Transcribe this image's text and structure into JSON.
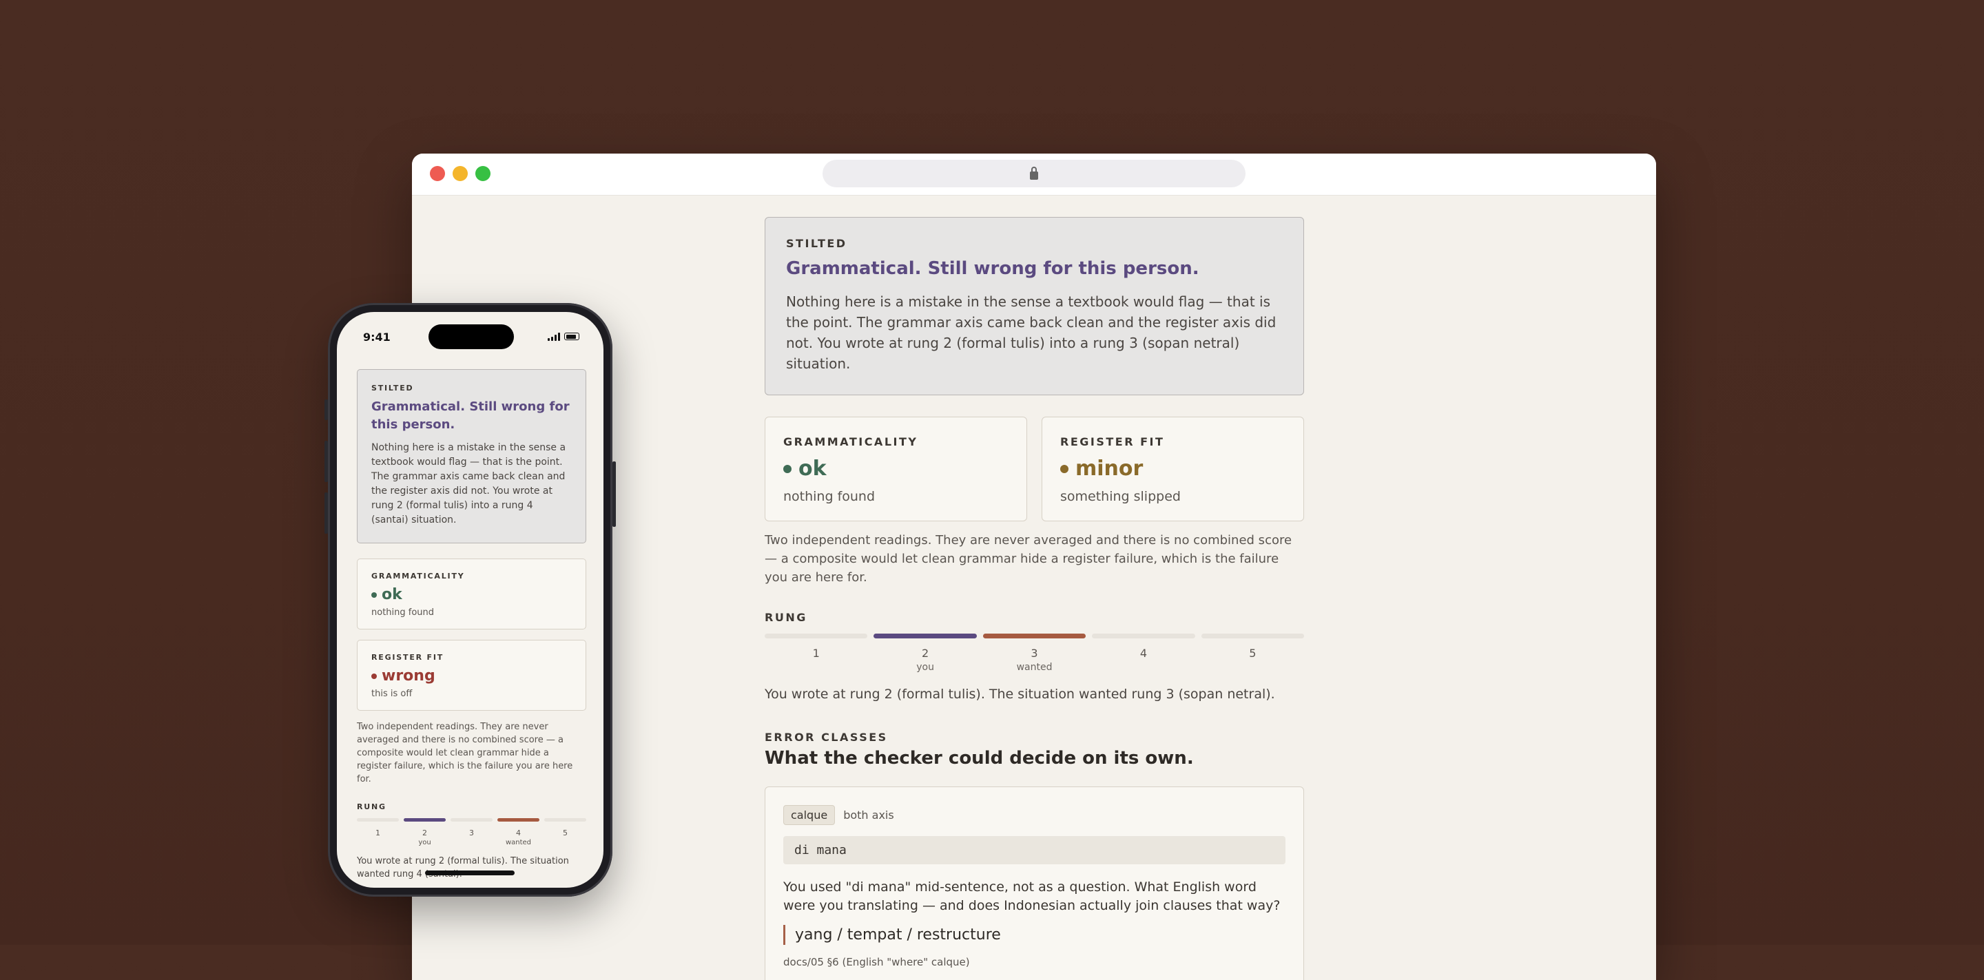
{
  "colors": {
    "accent": "#5b4a80",
    "ok": "#3f6b55",
    "minor": "#8a6a2a",
    "wrong": "#9b3b34",
    "you_bar": "#5b4a80",
    "wanted_bar": "#a65a40"
  },
  "desktop": {
    "verdict": {
      "label": "STILTED",
      "title": "Grammatical. Still wrong for this person.",
      "body": "Nothing here is a mistake in the sense a textbook would flag — that is the point. The grammar axis came back clean and the register axis did not. You wrote at rung 2 (formal tulis) into a rung 3 (sopan netral) situation."
    },
    "grammaticality": {
      "label": "GRAMMATICALITY",
      "value": "ok",
      "sub": "nothing found"
    },
    "register_fit": {
      "label": "REGISTER FIT",
      "value": "minor",
      "sub": "something slipped"
    },
    "note": "Two independent readings. They are never averaged and there is no combined score — a composite would let clean grammar hide a register failure, which is the failure you are here for.",
    "rung": {
      "label": "RUNG",
      "ticks": [
        {
          "n": "1",
          "m": ""
        },
        {
          "n": "2",
          "m": "you"
        },
        {
          "n": "3",
          "m": "wanted"
        },
        {
          "n": "4",
          "m": ""
        },
        {
          "n": "5",
          "m": ""
        }
      ],
      "you": 2,
      "wanted": 3,
      "summary": "You wrote at rung 2 (formal tulis). The situation wanted rung 3 (sopan netral)."
    },
    "error_classes": {
      "label": "ERROR CLASSES",
      "title": "What the checker could decide on its own.",
      "items": [
        {
          "chip": "calque",
          "axis": "both axis",
          "code": "di mana",
          "question": "You used \"di mana\" mid-sentence, not as a question. What English word were you translating — and does Indonesian actually join clauses that way?",
          "fix": "yang / tempat / restructure",
          "doc": "docs/05 §6 (English \"where\" calque)"
        }
      ]
    }
  },
  "phone": {
    "time": "9:41",
    "verdict": {
      "label": "STILTED",
      "title": "Grammatical. Still wrong for this person.",
      "body": "Nothing here is a mistake in the sense a textbook would flag — that is the point. The grammar axis came back clean and the register axis did not. You wrote at rung 2 (formal tulis) into a rung 4 (santai) situation."
    },
    "grammaticality": {
      "label": "GRAMMATICALITY",
      "value": "ok",
      "sub": "nothing found"
    },
    "register_fit": {
      "label": "REGISTER FIT",
      "value": "wrong",
      "sub": "this is off"
    },
    "note": "Two independent readings. They are never averaged and there is no combined score — a composite would let clean grammar hide a register failure, which is the failure you are here for.",
    "rung": {
      "label": "RUNG",
      "ticks": [
        {
          "n": "1",
          "m": ""
        },
        {
          "n": "2",
          "m": "you"
        },
        {
          "n": "3",
          "m": ""
        },
        {
          "n": "4",
          "m": "wanted"
        },
        {
          "n": "5",
          "m": ""
        }
      ],
      "you": 2,
      "wanted": 4,
      "summary": "You wrote at rung 2 (formal tulis). The situation wanted rung 4 (santai)."
    }
  }
}
